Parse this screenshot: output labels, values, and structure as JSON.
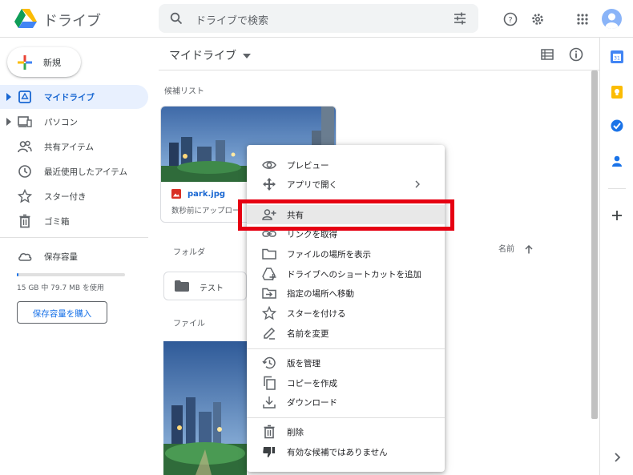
{
  "app": {
    "name": "ドライブ"
  },
  "search": {
    "placeholder": "ドライブで検索"
  },
  "sidebar": {
    "new_label": "新規",
    "items": [
      {
        "label": "マイドライブ",
        "icon": "my-drive-icon"
      },
      {
        "label": "パソコン",
        "icon": "computer-icon"
      },
      {
        "label": "共有アイテム",
        "icon": "shared-icon"
      },
      {
        "label": "最近使用したアイテム",
        "icon": "clock-icon"
      },
      {
        "label": "スター付き",
        "icon": "star-icon"
      },
      {
        "label": "ゴミ箱",
        "icon": "trash-icon"
      }
    ],
    "storage_label": "保存容量",
    "storage_usage": "15 GB 中 79.7 MB を使用",
    "storage_fraction": 0.0052,
    "buy_storage_label": "保存容量を購入"
  },
  "main": {
    "title": "マイドライブ",
    "suggested_label": "候補リスト",
    "suggested_file": {
      "name": "park.jpg",
      "meta": "数秒前にアップロー"
    },
    "folders_label": "フォルダ",
    "sort_label": "名前",
    "folder": {
      "name": "テスト"
    },
    "files_label": "ファイル"
  },
  "context_menu": {
    "items": [
      {
        "label": "プレビュー",
        "icon": "eye-icon"
      },
      {
        "label": "アプリで開く",
        "icon": "open-with-icon"
      },
      {
        "label": "共有",
        "icon": "person-add-icon"
      },
      {
        "label": "リンクを取得",
        "icon": "link-icon"
      },
      {
        "label": "ファイルの場所を表示",
        "icon": "folder-icon"
      },
      {
        "label": "ドライブへのショートカットを追加",
        "icon": "add-shortcut-icon"
      },
      {
        "label": "指定の場所へ移動",
        "icon": "move-icon"
      },
      {
        "label": "スターを付ける",
        "icon": "star-icon"
      },
      {
        "label": "名前を変更",
        "icon": "rename-icon"
      },
      {
        "label": "版を管理",
        "icon": "history-icon"
      },
      {
        "label": "コピーを作成",
        "icon": "copy-icon"
      },
      {
        "label": "ダウンロード",
        "icon": "download-icon"
      },
      {
        "label": "削除",
        "icon": "trash-icon"
      },
      {
        "label": "有効な候補ではありません",
        "icon": "thumb-down-icon"
      }
    ]
  },
  "colors": {
    "accent": "#1a73e8",
    "active_bg": "#e8f0fe",
    "highlight_box": "#e60012"
  }
}
